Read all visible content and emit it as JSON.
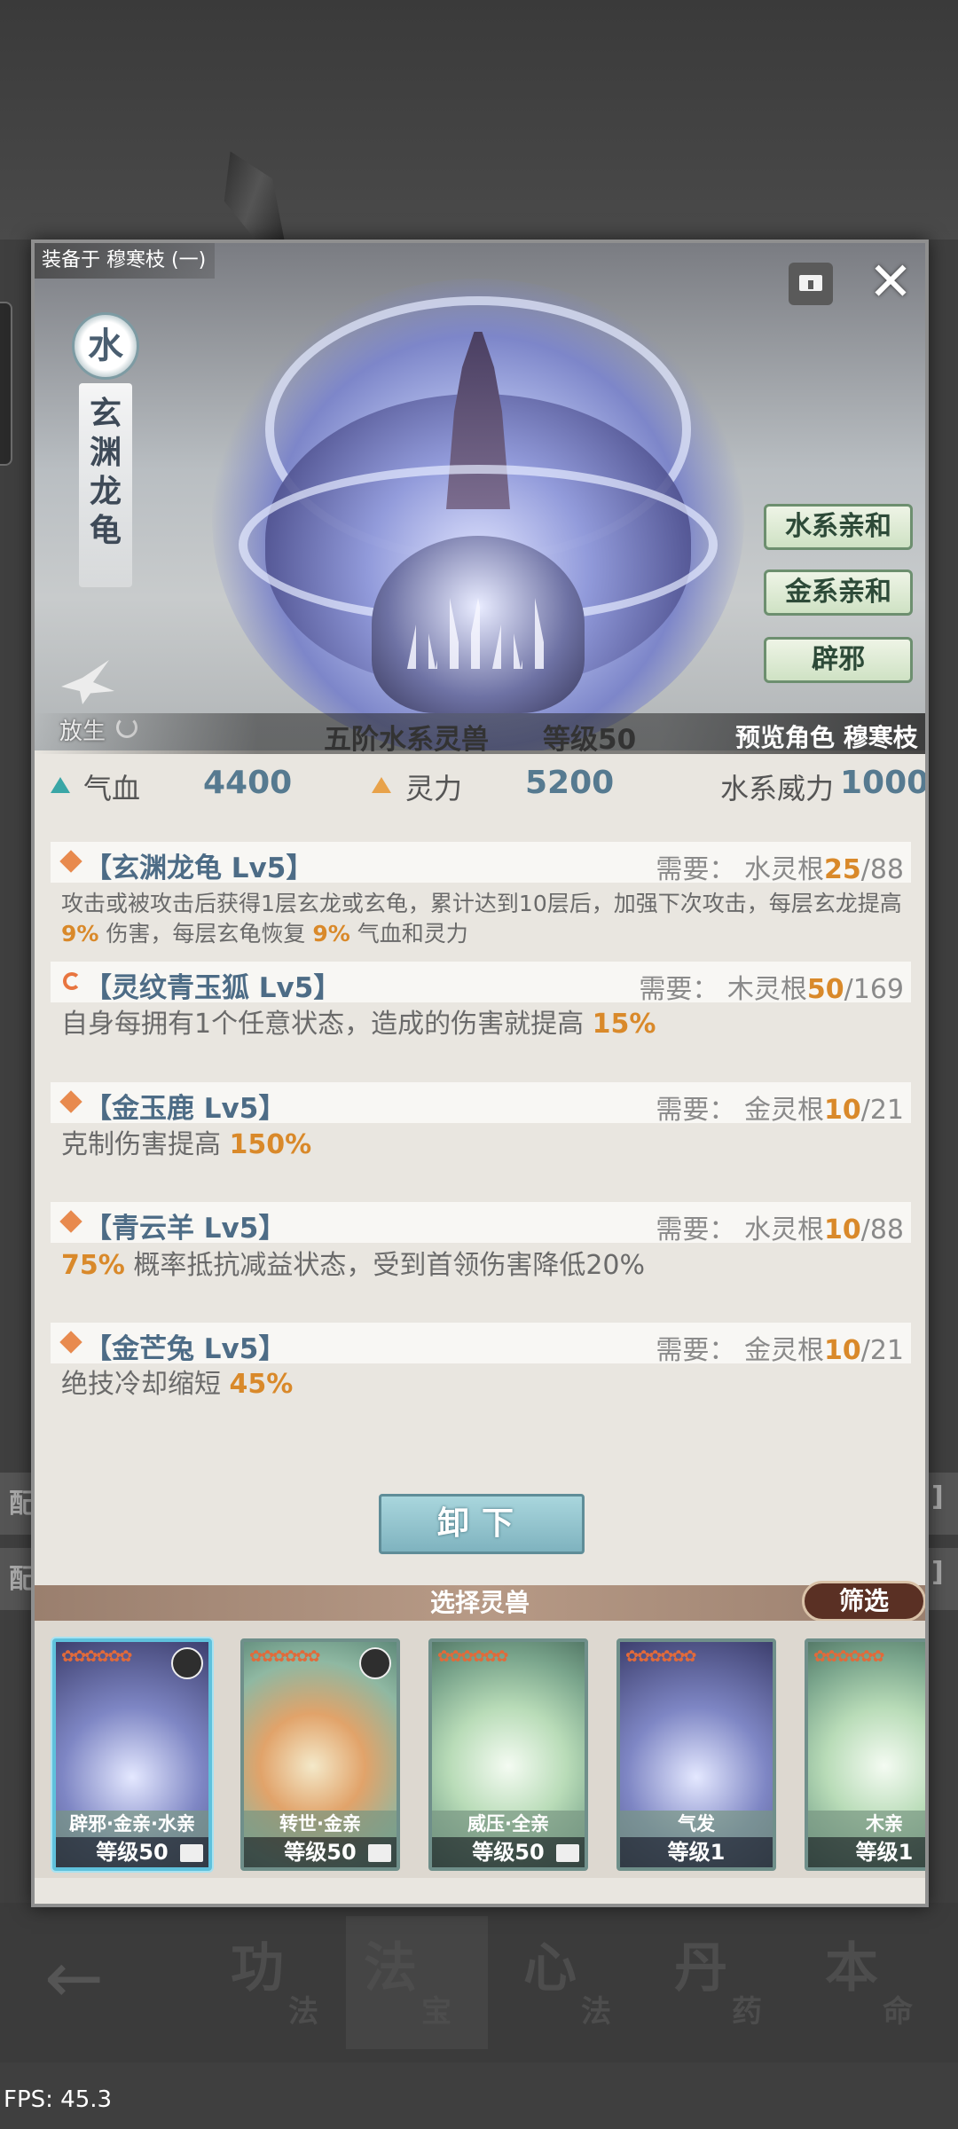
{
  "background": {
    "bands": [
      {
        "left": "配",
        "right": "]"
      },
      {
        "left": "配",
        "right": "]"
      }
    ]
  },
  "panel": {
    "equipped_label": "装备于 穆寒枝 (一)",
    "element": "水",
    "beast_name": "玄渊龙龟",
    "release_label": "放生",
    "affinity_buttons": [
      "水系亲和",
      "金系亲和",
      "辟邪"
    ],
    "rank_label": "五阶水系灵兽",
    "level_label": "等级50",
    "preview_label": "预览角色 穆寒枝"
  },
  "stats": [
    {
      "label": "气血",
      "value": "4400",
      "marker_color": "#3aa6a6"
    },
    {
      "label": "灵力",
      "value": "5200",
      "marker_color": "#e8a24a"
    },
    {
      "label": "水系威力",
      "value": "1000",
      "marker_color": ""
    }
  ],
  "skills": [
    {
      "title": "【玄渊龙龟 Lv5】",
      "icon": "diamond-icon",
      "req_prefix": "需要：  水灵根",
      "req_cur": "25",
      "req_total": "/88",
      "desc_parts": [
        "攻击或被攻击后获得1层玄龙或玄龟，累计达到10层后，加强下次攻击，每层玄龙提高 ",
        "9%",
        " 伤害，每层玄龟恢复 ",
        "9%",
        " 气血和灵力"
      ]
    },
    {
      "title": "【灵纹青玉狐 Lv5】",
      "icon": "cycle-icon",
      "req_prefix": "需要：  木灵根",
      "req_cur": "50",
      "req_total": "/169",
      "desc_parts": [
        "自身每拥有1个任意状态，造成的伤害就提高 ",
        "15%"
      ]
    },
    {
      "title": "【金玉鹿 Lv5】",
      "icon": "diamond-icon",
      "req_prefix": "需要：  金灵根",
      "req_cur": "10",
      "req_total": "/21",
      "desc_parts": [
        "克制伤害提高 ",
        "150%"
      ]
    },
    {
      "title": "【青云羊 Lv5】",
      "icon": "diamond-icon",
      "req_prefix": "需要：  水灵根",
      "req_cur": "10",
      "req_total": "/88",
      "desc_parts": [
        "75%",
        " 概率抵抗减益状态，受到首领伤害降低20%"
      ]
    },
    {
      "title": "【金芒兔 Lv5】",
      "icon": "diamond-icon",
      "req_prefix": "需要：  金灵根",
      "req_cur": "10",
      "req_total": "/21",
      "desc_parts": [
        "绝技冷却缩短 ",
        "45%"
      ]
    }
  ],
  "unload_label": "卸下",
  "select_title": "选择灵兽",
  "filter_label": "筛选",
  "cards": [
    {
      "stars": "✿✿✿✿✿✿",
      "tags": "辟邪·金亲·水亲",
      "level": "等级50",
      "style": "blue",
      "selected": true,
      "avatar": true,
      "lock": true
    },
    {
      "stars": "✿✿✿✿✿✿",
      "tags": "转世·金亲",
      "level": "等级50",
      "style": "orange",
      "selected": false,
      "avatar": true,
      "lock": true
    },
    {
      "stars": "✿✿✿✿✿✿",
      "tags": "威压·全亲",
      "level": "等级50",
      "style": "green",
      "selected": false,
      "avatar": false,
      "lock": true
    },
    {
      "stars": "✿✿✿✿✿✿",
      "tags": "气发",
      "level": "等级1",
      "style": "blue",
      "selected": false,
      "avatar": false,
      "lock": false
    },
    {
      "stars": "✿✿✿✿✿✿",
      "tags": "木亲",
      "level": "等级1",
      "style": "green",
      "selected": false,
      "avatar": false,
      "lock": false
    }
  ],
  "nav": [
    {
      "big": "功",
      "small": "法"
    },
    {
      "big": "法",
      "small": "宝"
    },
    {
      "big": "心",
      "small": "法"
    },
    {
      "big": "丹",
      "small": "药"
    },
    {
      "big": "本",
      "small": "命"
    }
  ],
  "fps": "FPS: 45.3"
}
